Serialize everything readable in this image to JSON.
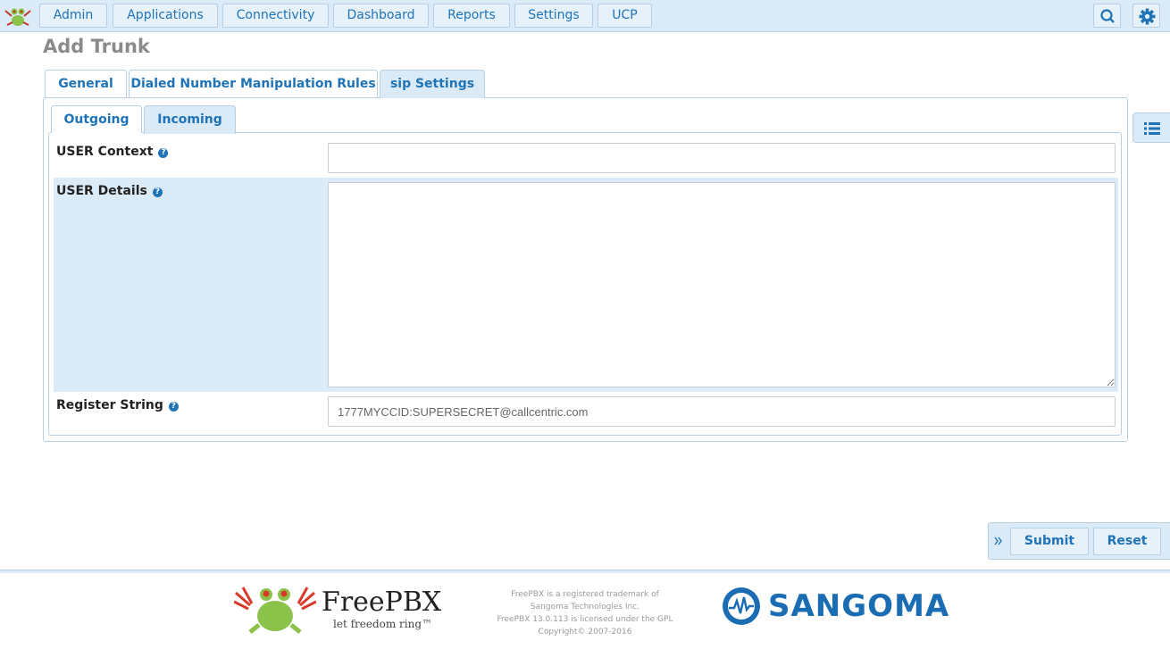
{
  "nav": {
    "items": [
      {
        "label": "Admin"
      },
      {
        "label": "Applications"
      },
      {
        "label": "Connectivity"
      },
      {
        "label": "Dashboard"
      },
      {
        "label": "Reports"
      },
      {
        "label": "Settings"
      },
      {
        "label": "UCP"
      }
    ]
  },
  "page": {
    "title": "Add Trunk"
  },
  "tabs": {
    "main": [
      "General",
      "Dialed Number Manipulation Rules",
      "sip Settings"
    ],
    "sub": [
      "Outgoing",
      "Incoming"
    ]
  },
  "form": {
    "user_context": {
      "label": "USER Context",
      "value": ""
    },
    "user_details": {
      "label": "USER Details",
      "value": ""
    },
    "register_string": {
      "label": "Register String",
      "value": "1777MYCCID:SUPERSECRET@callcentric.com"
    }
  },
  "actions": {
    "submit": "Submit",
    "reset": "Reset"
  },
  "footer": {
    "freepbx": "FreePBX",
    "tagline": "let freedom ring™",
    "legal": [
      "FreePBX is a registered trademark of",
      "Sangoma Technologies Inc.",
      "FreePBX 13.0.113 is licensed under the GPL",
      "Copyright© 2007-2016"
    ],
    "sangoma": "SANGOMA"
  },
  "colors": {
    "accent": "#1f73b7",
    "panel": "#dbeaf7",
    "sangoma": "#1b6db3"
  }
}
